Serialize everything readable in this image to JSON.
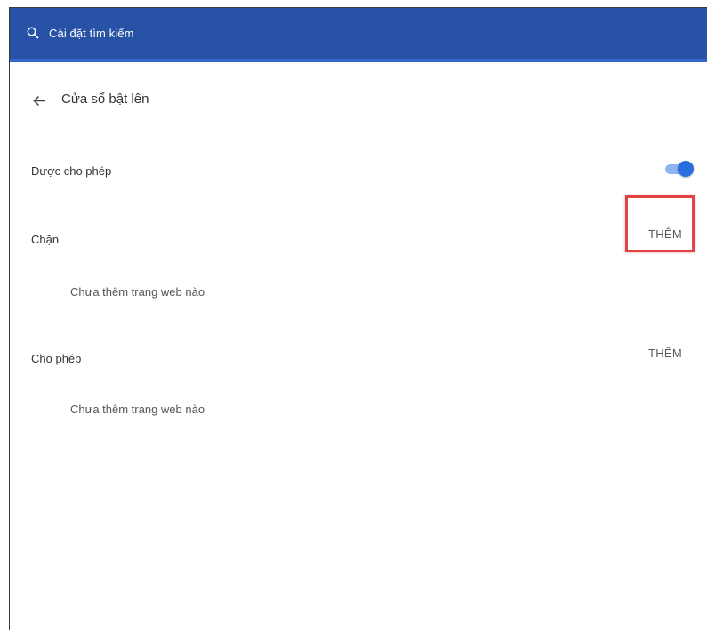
{
  "search": {
    "placeholder": "Cài đặt tìm kiếm",
    "icon": "search-icon"
  },
  "header": {
    "back_icon": "back-arrow-icon",
    "title": "Cửa sổ bật lên"
  },
  "allowed": {
    "label": "Được cho phép",
    "enabled": true
  },
  "blocked": {
    "label": "Chặn",
    "add_label": "THÊM",
    "empty_text": "Chưa thêm trang web nào"
  },
  "allow": {
    "label": "Cho phép",
    "add_label": "THÊM",
    "empty_text": "Chưa thêm trang web nào"
  },
  "colors": {
    "topbar": "#2752a5",
    "toggle_on": "#2a6ddd",
    "highlight": "#e04444"
  }
}
